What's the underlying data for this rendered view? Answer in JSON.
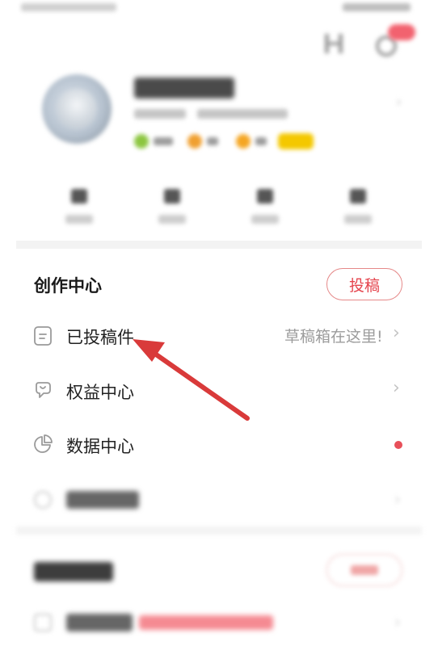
{
  "creation_center": {
    "title": "创作中心",
    "submit_button": "投稿",
    "items": [
      {
        "label": "已投稿件",
        "hint": "草稿箱在这里!",
        "icon": "document-icon"
      },
      {
        "label": "权益中心",
        "hint": "",
        "icon": "benefit-icon"
      },
      {
        "label": "数据中心",
        "hint": "",
        "icon": "pie-chart-icon"
      }
    ]
  },
  "colors": {
    "accent_red": "#e5454e",
    "arrow_red": "#d93a3a",
    "notification_dot": "#e8505a",
    "vip_yellow": "#f4c800"
  }
}
